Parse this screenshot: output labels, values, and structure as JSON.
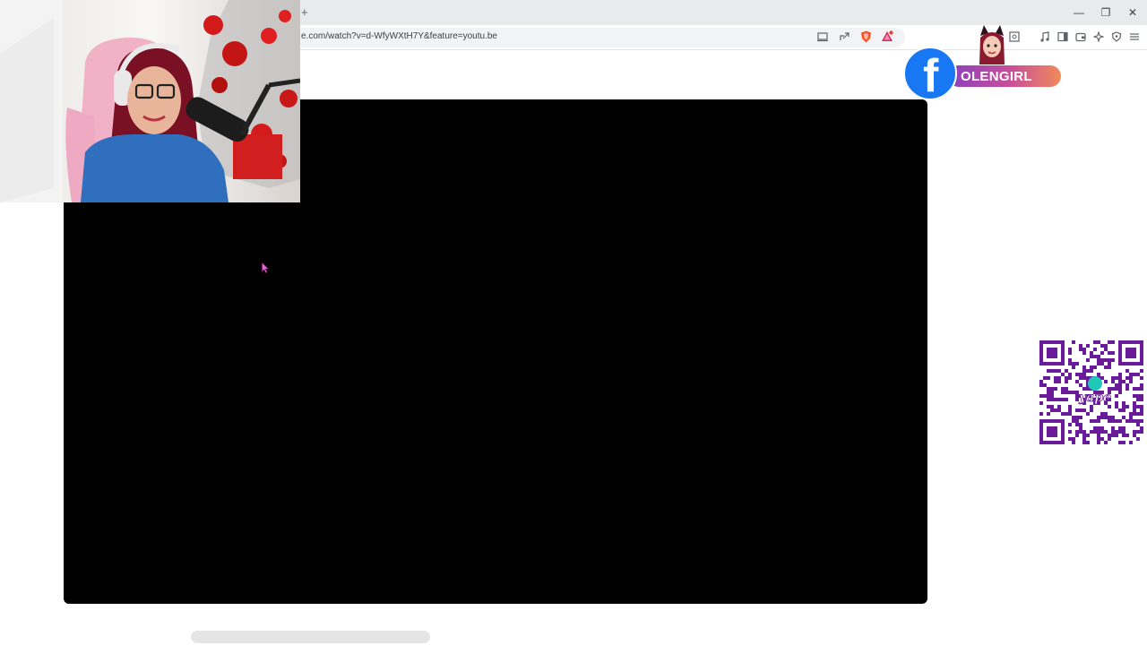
{
  "browser": {
    "new_tab_symbol": "+",
    "url": "e.com/watch?v=d-WfyWXtH7Y&feature=youtu.be",
    "window_controls": {
      "minimize": "—",
      "restore": "❐",
      "close": "✕"
    },
    "url_icons": [
      "cast-icon",
      "share-icon",
      "brave-shield-icon",
      "brave-rewards-icon"
    ],
    "toolbar_icons": [
      "screenshot-icon",
      "music-icon",
      "sidebar-icon",
      "wallet-icon",
      "leo-ai-icon",
      "vpn-icon",
      "menu-icon"
    ]
  },
  "page": {
    "video_player": {
      "state": "black"
    }
  },
  "overlays": {
    "facebook_badge": {
      "name": "OLENGIRL",
      "icon": "facebook-icon",
      "color": "#1877f2"
    },
    "qr_code": {
      "brand": "yape",
      "accent": "#6a1b9a"
    }
  },
  "colors": {
    "brave_shield": "#fb542b",
    "rewards": "#e0245e"
  }
}
